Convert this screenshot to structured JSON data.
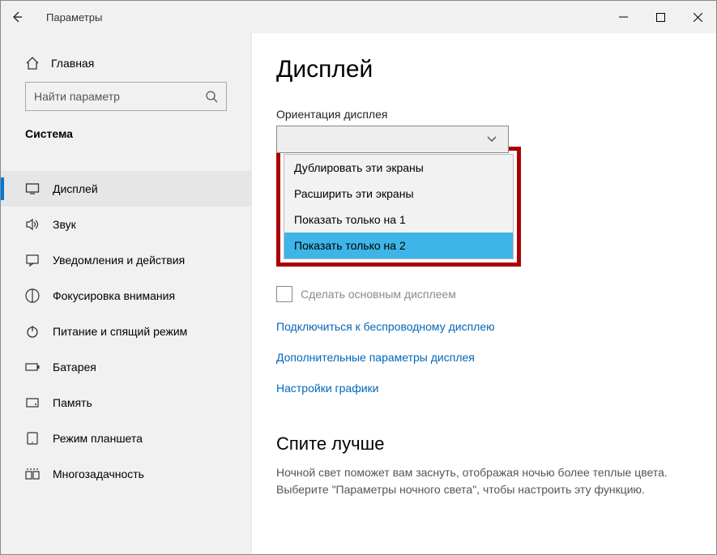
{
  "window": {
    "title": "Параметры"
  },
  "sidebar": {
    "home_label": "Главная",
    "search_placeholder": "Найти параметр",
    "category": "Система",
    "items": [
      {
        "label": "Дисплей",
        "icon": "display",
        "active": true
      },
      {
        "label": "Звук",
        "icon": "sound",
        "active": false
      },
      {
        "label": "Уведомления и действия",
        "icon": "notifications",
        "active": false
      },
      {
        "label": "Фокусировка внимания",
        "icon": "focus",
        "active": false
      },
      {
        "label": "Питание и спящий режим",
        "icon": "power",
        "active": false
      },
      {
        "label": "Батарея",
        "icon": "battery",
        "active": false
      },
      {
        "label": "Память",
        "icon": "storage",
        "active": false
      },
      {
        "label": "Режим планшета",
        "icon": "tablet",
        "active": false
      },
      {
        "label": "Многозадачность",
        "icon": "multitask",
        "active": false
      }
    ]
  },
  "main": {
    "title": "Дисплей",
    "orientation_label": "Ориентация дисплея",
    "dropdown_options": [
      {
        "label": "Дублировать эти экраны",
        "selected": false
      },
      {
        "label": "Расширить эти экраны",
        "selected": false
      },
      {
        "label": "Показать только на 1",
        "selected": false
      },
      {
        "label": "Показать только на 2",
        "selected": true
      }
    ],
    "checkbox_label": "Сделать основным дисплеем",
    "links": [
      "Подключиться к беспроводному дисплею",
      "Дополнительные параметры дисплея",
      "Настройки графики"
    ],
    "sleep_heading": "Спите лучше",
    "sleep_body": "Ночной свет поможет вам заснуть, отображая ночью более теплые цвета. Выберите \"Параметры ночного света\", чтобы настроить эту функцию."
  }
}
